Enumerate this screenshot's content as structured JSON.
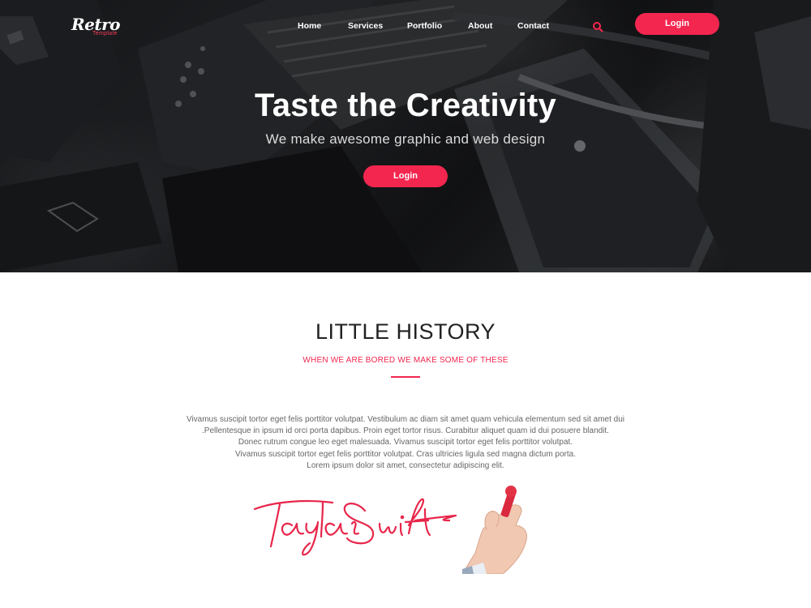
{
  "nav": {
    "logo_main": "Retro",
    "logo_sub": "Template",
    "items": [
      {
        "label": "Home"
      },
      {
        "label": "Services"
      },
      {
        "label": "Portfolio"
      },
      {
        "label": "About"
      },
      {
        "label": "Contact"
      }
    ],
    "search_icon": "search-icon",
    "login_label": "Login"
  },
  "hero": {
    "title": "Taste the Creativity",
    "subtitle": "We make awesome graphic and web design",
    "button_label": "Login"
  },
  "history": {
    "title": "LITTLE HISTORY",
    "subtitle": "WHEN WE ARE BORED WE MAKE SOME OF THESE",
    "paragraph_lines": [
      "Vivamus suscipit tortor eget felis porttitor volutpat. Vestibulum ac diam sit amet quam vehicula elementum sed sit amet dui",
      ".Pellentesque in ipsum id orci porta dapibus. Proin eget tortor risus. Curabitur aliquet quam id dui posuere blandit.",
      "Donec rutrum congue leo eget malesuada. Vivamus suscipit tortor eget felis porttitor volutpat.",
      "Vivamus suscipit tortor eget felis porttitor volutpat. Cras ultricies ligula sed magna dictum porta.",
      "Lorem ipsum dolor sit amet, consectetur adipiscing elit."
    ],
    "signature_text": "Taylor Swift"
  },
  "colors": {
    "accent": "#f3264f",
    "hero_text": "#ffffff",
    "body_text": "#666666"
  }
}
